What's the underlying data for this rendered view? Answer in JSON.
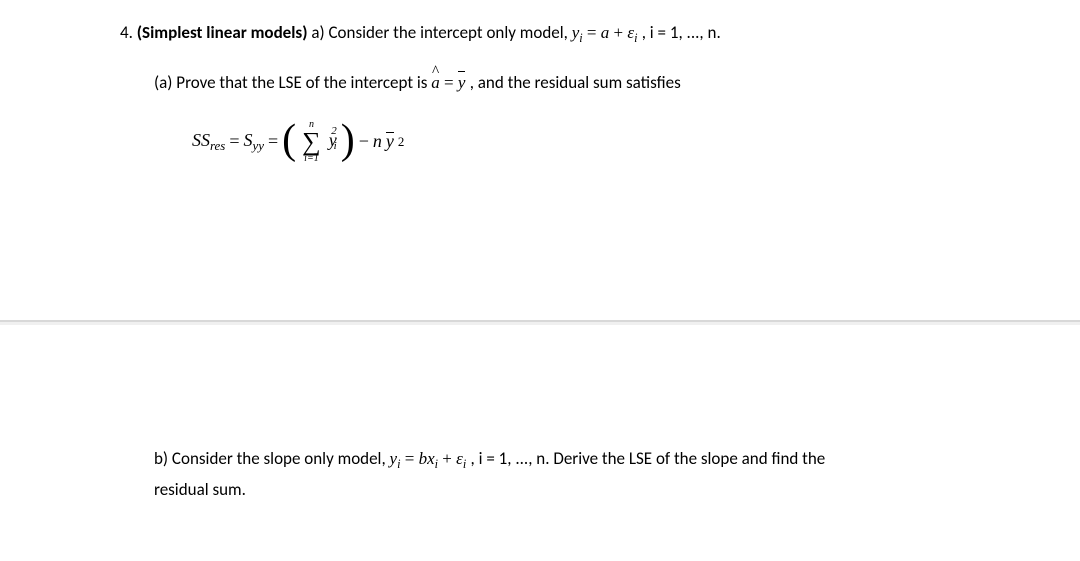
{
  "problem": {
    "number": "4.",
    "title_bold": "(Simplest linear models)",
    "intro_a": " a) Consider the intercept only model,  ",
    "intro_eq_y": "y",
    "intro_eq_sub_i1": "i",
    "intro_eq_eq": " = ",
    "intro_eq_a": "a",
    "intro_eq_plus": " + ",
    "intro_eq_eps": "ε",
    "intro_eq_sub_i2": "i",
    "intro_tail": " , i = 1, ..., n."
  },
  "part_a": {
    "label": "(a) Prove that the LSE of the intercept is  ",
    "a_hat": "a",
    "eq_text": " =  ",
    "y_bar": "y",
    "tail": " , and the residual sum satisfies"
  },
  "equation": {
    "ss": "SS",
    "res": "res",
    "eq1": " = ",
    "s": "S",
    "yy": "yy",
    "eq2": " = ",
    "lparen": "(",
    "sigma_top": "n",
    "sigma": "∑",
    "sigma_bot": "i=1",
    "y": "y",
    "i": "i",
    "sq1": "2",
    "rparen": ")",
    "minus": " − ",
    "n": "n",
    "ybar": "y",
    "sq2": "2"
  },
  "part_b": {
    "label": "b) Consider the slope only model,  ",
    "y": "y",
    "sub_i1": "i",
    "eq": " = ",
    "b": "b",
    "x": "x",
    "sub_i2": "i",
    "plus": " + ",
    "eps": "ε",
    "sub_i3": "i",
    "mid": ", i = 1, ..., n. Derive the LSE of the slope and find the",
    "line2": "residual sum."
  }
}
